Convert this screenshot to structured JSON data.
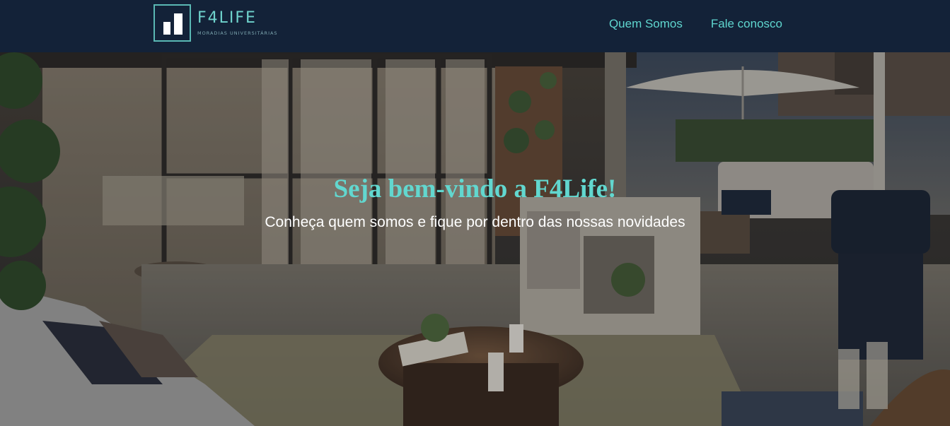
{
  "header": {
    "logo": {
      "name": "F4LIFE",
      "tagline": "MORADIAS UNIVERSITÁRIAS"
    },
    "nav": [
      {
        "label": "Quem Somos"
      },
      {
        "label": "Fale conosco"
      }
    ]
  },
  "hero": {
    "title": "Seja bem-vindo a F4Life!",
    "subtitle": "Conheça quem somos e fique por dentro das nossas novidades"
  },
  "colors": {
    "navbar_bg": "#132238",
    "accent": "#5fd6cf",
    "title": "#62d7cf",
    "subtitle": "#ffffff"
  }
}
